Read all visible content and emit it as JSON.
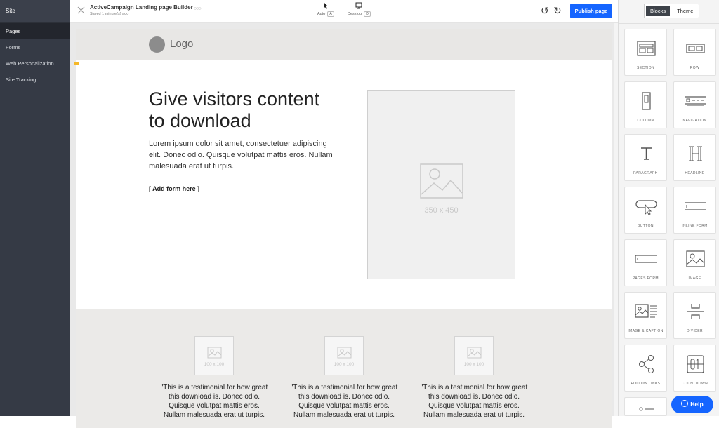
{
  "sidebar": {
    "title": "Site",
    "items": [
      {
        "label": "Pages",
        "active": true
      },
      {
        "label": "Forms"
      },
      {
        "label": "Web Personalization"
      },
      {
        "label": "Site Tracking"
      }
    ]
  },
  "topbar": {
    "app_title": "ActiveCampaign Landing page Builder",
    "saved_text": "Saved 1 minute(s) ago",
    "mode_auto": {
      "label": "Auto",
      "key": "A"
    },
    "mode_desktop": {
      "label": "Desktop",
      "key": "D"
    },
    "publish_label": "Publish page"
  },
  "panel": {
    "tabs": [
      {
        "label": "Blocks",
        "active": true
      },
      {
        "label": "Theme"
      }
    ],
    "blocks": [
      {
        "label": "SECTION",
        "icon": "section-icon"
      },
      {
        "label": "ROW",
        "icon": "row-icon"
      },
      {
        "label": "COLUMN",
        "icon": "column-icon"
      },
      {
        "label": "NAVIGATION",
        "icon": "navigation-icon"
      },
      {
        "label": "PARAGRAPH",
        "icon": "paragraph-icon"
      },
      {
        "label": "HEADLINE",
        "icon": "headline-icon"
      },
      {
        "label": "BUTTON",
        "icon": "button-icon"
      },
      {
        "label": "INLINE FORM",
        "icon": "inline-form-icon"
      },
      {
        "label": "PAGES FORM",
        "icon": "pages-form-icon"
      },
      {
        "label": "IMAGE",
        "icon": "image-icon"
      },
      {
        "label": "IMAGE & CAPTION",
        "icon": "image-caption-icon"
      },
      {
        "label": "DIVIDER",
        "icon": "divider-icon"
      },
      {
        "label": "FOLLOW LINKS",
        "icon": "share-icon"
      },
      {
        "label": "COUNTDOWN",
        "icon": "countdown-icon"
      }
    ]
  },
  "help_label": "Help",
  "page": {
    "logo_text": "Logo",
    "hero": {
      "headline": "Give visitors content to download",
      "body": "Lorem ipsum dolor sit amet, consectetuer adipiscing elit. Donec odio. Quisque volutpat mattis eros. Nullam malesuada erat ut turpis.",
      "form_placeholder": "[ Add form here ]",
      "image_label": "350 x 450"
    },
    "testimonials": [
      {
        "image_label": "100 x 100",
        "text": "\"This is a testimonial for how great this download is. Donec odio. Quisque volutpat mattis eros. Nullam malesuada erat ut turpis."
      },
      {
        "image_label": "100 x 100",
        "text": "\"This is a testimonial for how great this download is. Donec odio. Quisque volutpat mattis eros. Nullam malesuada erat ut turpis."
      },
      {
        "image_label": "100 x 100",
        "text": "\"This is a testimonial for how great this download is. Donec odio. Quisque volutpat mattis eros. Nullam malesuada erat ut turpis."
      }
    ]
  },
  "colors": {
    "accent": "#1565ff",
    "sidebar": "#353a45"
  }
}
